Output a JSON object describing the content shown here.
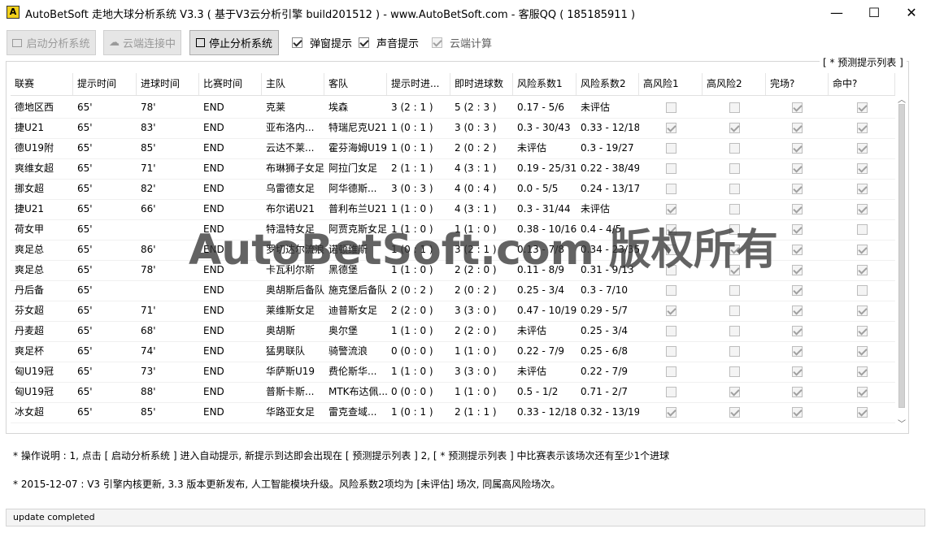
{
  "app": {
    "title": "AutoBetSoft 走地大球分析系统 V3.3 ( 基于V3云分析引擎 build201512 ) - www.AutoBetSoft.com - 客服QQ ( 185185911 )",
    "icon_label": "A",
    "icon_color": "#f1d01a"
  },
  "window": {
    "minimize": "—",
    "maximize": "☐",
    "close": "✕"
  },
  "toolbar": {
    "start_label": "启动分析系统",
    "cloud_label": "云端连接中",
    "stop_label": "停止分析系统",
    "popup_label": "弹窗提示",
    "popup_checked": true,
    "sound_label": "声音提示",
    "sound_checked": true,
    "cloud_calc_label": "云端计算",
    "cloud_calc_checked": true
  },
  "group": {
    "title": "[ * 预测提示列表 ]"
  },
  "table": {
    "headers": [
      "联赛",
      "提示时间",
      "进球时间",
      "比赛时间",
      "主队",
      "客队",
      "提示时进...",
      "即时进球数",
      "风险系数1",
      "风险系数2",
      "高风险1",
      "高风险2",
      "完场?",
      "命中?"
    ],
    "rows": [
      {
        "league": "德地区西",
        "tip_time": "65'",
        "goal_time": "78'",
        "match_time": "END",
        "home": "克莱",
        "away": "埃森",
        "tip_score": "3 (2 : 1 )",
        "live_goals": "5 (2 : 3 )",
        "risk1": "0.17 - 5/6",
        "risk2": "未评估",
        "high1": false,
        "high2": false,
        "finished": true,
        "hit": true
      },
      {
        "league": "捷U21",
        "tip_time": "65'",
        "goal_time": "83'",
        "match_time": "END",
        "home": "亚布洛内...",
        "away": "特瑞尼克U21",
        "tip_score": "1 (0 : 1 )",
        "live_goals": "3 (0 : 3 )",
        "risk1": "0.3 - 30/43",
        "risk2": "0.33 - 12/18",
        "high1": true,
        "high2": true,
        "finished": true,
        "hit": true
      },
      {
        "league": "德U19附",
        "tip_time": "65'",
        "goal_time": "85'",
        "match_time": "END",
        "home": "云达不莱...",
        "away": "霍芬海姆U19",
        "tip_score": "1 (0 : 1 )",
        "live_goals": "2 (0 : 2 )",
        "risk1": "未评估",
        "risk2": "0.3 - 19/27",
        "high1": false,
        "high2": false,
        "finished": true,
        "hit": true
      },
      {
        "league": "爽维女超",
        "tip_time": "65'",
        "goal_time": "71'",
        "match_time": "END",
        "home": "布琳狮子女足",
        "away": "阿拉门女足",
        "tip_score": "2 (1 : 1 )",
        "live_goals": "4 (3 : 1 )",
        "risk1": "0.19 - 25/31",
        "risk2": "0.22 - 38/49",
        "high1": false,
        "high2": false,
        "finished": true,
        "hit": true
      },
      {
        "league": "挪女超",
        "tip_time": "65'",
        "goal_time": "82'",
        "match_time": "END",
        "home": "乌雷德女足",
        "away": "阿华德斯...",
        "tip_score": "3 (0 : 3 )",
        "live_goals": "4 (0 : 4 )",
        "risk1": "0.0 - 5/5",
        "risk2": "0.24 - 13/17",
        "high1": false,
        "high2": false,
        "finished": true,
        "hit": true
      },
      {
        "league": "捷U21",
        "tip_time": "65'",
        "goal_time": "66'",
        "match_time": "END",
        "home": "布尔诺U21",
        "away": "普利布兰U21",
        "tip_score": "1 (1 : 0 )",
        "live_goals": "4 (3 : 1 )",
        "risk1": "0.3 - 31/44",
        "risk2": "未评估",
        "high1": true,
        "high2": false,
        "finished": true,
        "hit": true
      },
      {
        "league": "荷女甲",
        "tip_time": "65'",
        "goal_time": "",
        "match_time": "END",
        "home": "特温特女足",
        "away": "阿贾克斯女足",
        "tip_score": "1 (1 : 0 )",
        "live_goals": "1 (1 : 0 )",
        "risk1": "0.38 - 10/16",
        "risk2": "0.4 - 4/5",
        "high1": true,
        "high2": false,
        "finished": true,
        "hit": false
      },
      {
        "league": "爽足总",
        "tip_time": "65'",
        "goal_time": "86'",
        "match_time": "END",
        "home": "罗切达尔流浪",
        "away": "诺顿维斯",
        "tip_score": "1 (0 : 1 )",
        "live_goals": "3 (2 : 1 )",
        "risk1": "0.13 - 7/8",
        "risk2": "0.34 - 23/35",
        "high1": false,
        "high2": true,
        "finished": true,
        "hit": true
      },
      {
        "league": "爽足总",
        "tip_time": "65'",
        "goal_time": "78'",
        "match_time": "END",
        "home": "卡瓦利尔斯",
        "away": "黑德堡",
        "tip_score": "1 (1 : 0 )",
        "live_goals": "2 (2 : 0 )",
        "risk1": "0.11 - 8/9",
        "risk2": "0.31 - 9/13",
        "high1": false,
        "high2": true,
        "finished": true,
        "hit": true
      },
      {
        "league": "丹后备",
        "tip_time": "65'",
        "goal_time": "",
        "match_time": "END",
        "home": "奥胡斯后备队",
        "away": "施克堡后备队",
        "tip_score": "2 (0 : 2 )",
        "live_goals": "2 (0 : 2 )",
        "risk1": "0.25 - 3/4",
        "risk2": "0.3 - 7/10",
        "high1": false,
        "high2": false,
        "finished": true,
        "hit": false
      },
      {
        "league": "芬女超",
        "tip_time": "65'",
        "goal_time": "71'",
        "match_time": "END",
        "home": "莱维斯女足",
        "away": "迪普斯女足",
        "tip_score": "2 (2 : 0 )",
        "live_goals": "3 (3 : 0 )",
        "risk1": "0.47 - 10/19",
        "risk2": "0.29 - 5/7",
        "high1": true,
        "high2": false,
        "finished": true,
        "hit": true
      },
      {
        "league": "丹麦超",
        "tip_time": "65'",
        "goal_time": "68'",
        "match_time": "END",
        "home": "奥胡斯",
        "away": "奥尔堡",
        "tip_score": "1 (1 : 0 )",
        "live_goals": "2 (2 : 0 )",
        "risk1": "未评估",
        "risk2": "0.25 - 3/4",
        "high1": false,
        "high2": false,
        "finished": true,
        "hit": true
      },
      {
        "league": "爽足杯",
        "tip_time": "65'",
        "goal_time": "74'",
        "match_time": "END",
        "home": "猛男联队",
        "away": "骑警流浪",
        "tip_score": "0 (0 : 0 )",
        "live_goals": "1 (1 : 0 )",
        "risk1": "0.22 - 7/9",
        "risk2": "0.25 - 6/8",
        "high1": false,
        "high2": false,
        "finished": true,
        "hit": true
      },
      {
        "league": "匈U19冠",
        "tip_time": "65'",
        "goal_time": "73'",
        "match_time": "END",
        "home": "华萨斯U19",
        "away": "费伦斯华...",
        "tip_score": "1 (1 : 0 )",
        "live_goals": "3 (3 : 0 )",
        "risk1": "未评估",
        "risk2": "0.22 - 7/9",
        "high1": false,
        "high2": false,
        "finished": true,
        "hit": true
      },
      {
        "league": "匈U19冠",
        "tip_time": "65'",
        "goal_time": "88'",
        "match_time": "END",
        "home": "普斯卡斯...",
        "away": "MTK布达佩...",
        "tip_score": "0 (0 : 0 )",
        "live_goals": "1 (1 : 0 )",
        "risk1": "0.5 - 1/2",
        "risk2": "0.71 - 2/7",
        "high1": false,
        "high2": true,
        "finished": true,
        "hit": true
      },
      {
        "league": "冰女超",
        "tip_time": "65'",
        "goal_time": "85'",
        "match_time": "END",
        "home": "华路亚女足",
        "away": "雷克查域...",
        "tip_score": "1 (0 : 1 )",
        "live_goals": "2 (1 : 1 )",
        "risk1": "0.33 - 12/18",
        "risk2": "0.32 - 13/19",
        "high1": true,
        "high2": true,
        "finished": true,
        "hit": true
      }
    ]
  },
  "watermark": "AutoBetSoft.com 版权所有",
  "info": {
    "line1": "* 操作说明 : 1, 点击 [ 启动分析系统 ] 进入自动提示, 新提示到达即会出现在 [ 预测提示列表 ] 2, [ * 预测提示列表 ] 中比赛表示该场次还有至少1个进球",
    "line2": "* 2015-12-07 : V3 引擎内核更新, 3.3 版本更新发布, 人工智能模块升级。风险系数2项均为 [未评估] 场次, 同属高风险场次。"
  },
  "status": {
    "text": "update completed"
  }
}
